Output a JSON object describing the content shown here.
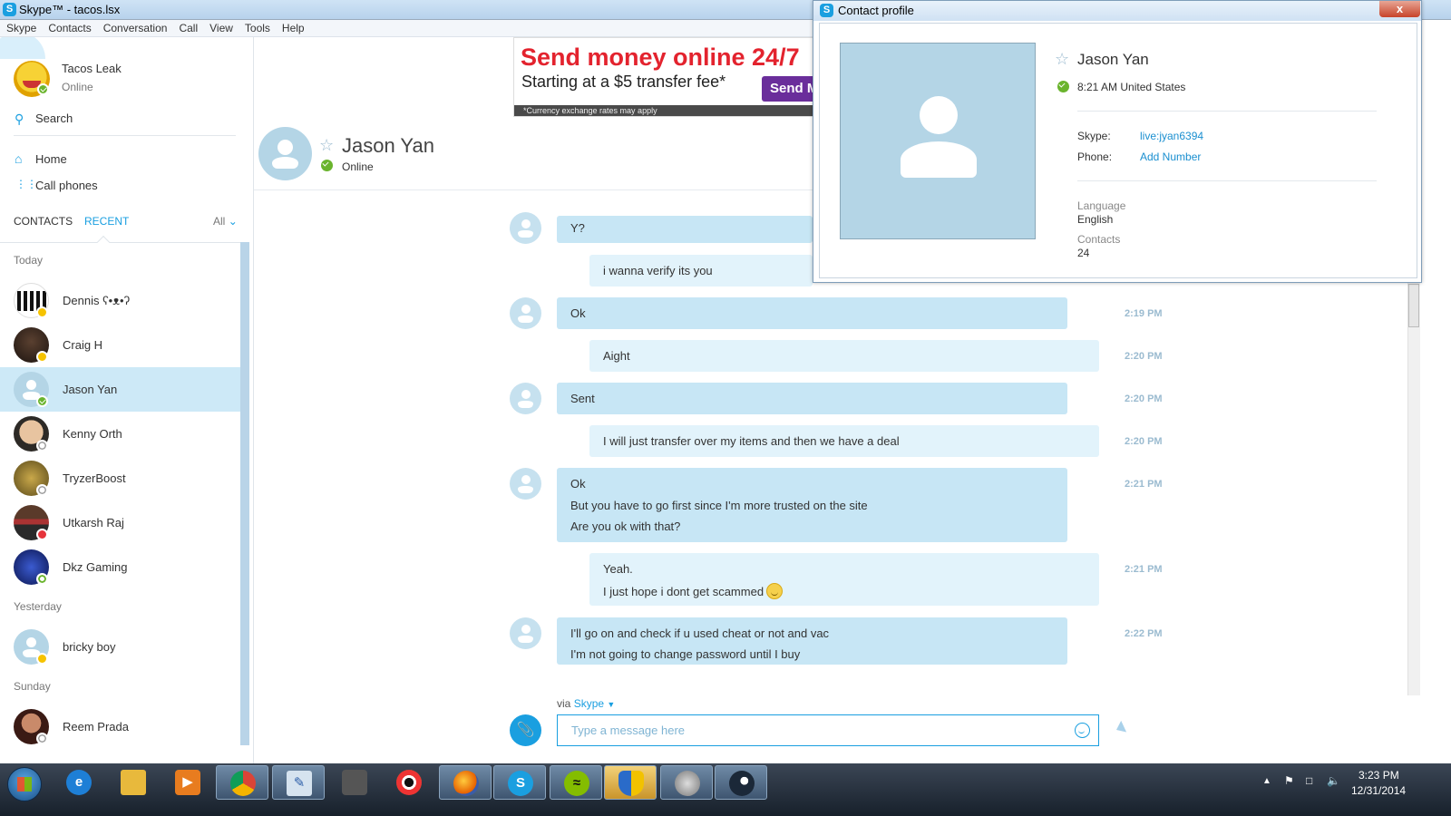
{
  "window": {
    "title": "Skype™ - tacos.lsx",
    "logo": "skype-logo-icon"
  },
  "menu": [
    "Skype",
    "Contacts",
    "Conversation",
    "Call",
    "View",
    "Tools",
    "Help"
  ],
  "me": {
    "name": "Tacos Leak",
    "status": "Online"
  },
  "search_label": "Search",
  "nav": {
    "home": "Home",
    "call_phones": "Call phones"
  },
  "tabs": {
    "contacts": "CONTACTS",
    "recent": "RECENT",
    "filter": "All"
  },
  "groups": {
    "today": "Today",
    "yesterday": "Yesterday",
    "sunday": "Sunday"
  },
  "contacts": [
    {
      "name": "Dennis ʕ•ᴥ•ʔ",
      "status": "away"
    },
    {
      "name": "Craig H",
      "status": "away"
    },
    {
      "name": "Jason Yan",
      "status": "online"
    },
    {
      "name": "Kenny Orth",
      "status": "offline"
    },
    {
      "name": "TryzerBoost",
      "status": "offline"
    },
    {
      "name": "Utkarsh Raj",
      "status": "dnd"
    },
    {
      "name": "Dkz Gaming",
      "status": "online-mobile"
    },
    {
      "name": "bricky boy",
      "status": "away"
    },
    {
      "name": "Reem Prada",
      "status": "offline"
    }
  ],
  "ad": {
    "headline": "Send money online 24/7",
    "sub": "Starting at a $5 transfer fee*",
    "button": "Send M",
    "fine_print": "*Currency exchange rates may apply"
  },
  "conversation": {
    "name": "Jason Yan",
    "status": "Online"
  },
  "messages": [
    {
      "dir": "in",
      "lines": [
        "Y?"
      ],
      "time": ""
    },
    {
      "dir": "out",
      "lines": [
        "i wanna verify its you"
      ],
      "time": ""
    },
    {
      "dir": "in",
      "lines": [
        "Ok"
      ],
      "time": "2:19 PM"
    },
    {
      "dir": "out",
      "lines": [
        "Aight"
      ],
      "time": "2:20 PM"
    },
    {
      "dir": "in",
      "lines": [
        "Sent"
      ],
      "time": "2:20 PM"
    },
    {
      "dir": "out",
      "lines": [
        "I will just transfer over my items and then we have a deal"
      ],
      "time": "2:20 PM"
    },
    {
      "dir": "in",
      "lines": [
        "Ok",
        "But you have to go first since I'm more trusted on the site",
        "Are you ok with that?"
      ],
      "time": "2:21 PM"
    },
    {
      "dir": "out",
      "lines": [
        "Yeah.",
        "I just hope i dont get scammed"
      ],
      "time": "2:21 PM"
    },
    {
      "dir": "in",
      "lines": [
        "I'll go on and check if u used cheat or not and vac",
        "I'm not going to change password until I buy"
      ],
      "time": "2:22 PM"
    }
  ],
  "composer": {
    "via_prefix": "via",
    "via_service": "Skype",
    "placeholder": "Type a message here"
  },
  "profile_popup": {
    "window_title": "Contact profile",
    "close": "x",
    "name": "Jason Yan",
    "local_time": "8:21 AM United States",
    "skype_label": "Skype:",
    "skype_value": "live:jyan6394",
    "phone_label": "Phone:",
    "phone_value": "Add Number",
    "language_label": "Language",
    "language_value": "English",
    "contacts_label": "Contacts",
    "contacts_value": "24"
  },
  "taskbar": {
    "apps": [
      "internet-explorer-icon",
      "file-explorer-icon",
      "media-player-icon",
      "chrome-icon",
      "notepad-icon",
      "camera-icon",
      "music-player-icon",
      "firefox-icon",
      "skype-icon",
      "spotify-icon",
      "security-icon",
      "speaker-icon",
      "steam-icon"
    ],
    "time": "3:23 PM",
    "date": "12/31/2014"
  },
  "colors": {
    "accent": "#1a9fe0",
    "bubble_in": "#c7e6f5",
    "bubble_out": "#e2f3fb",
    "online": "#6ab42d",
    "away": "#f6c300"
  }
}
